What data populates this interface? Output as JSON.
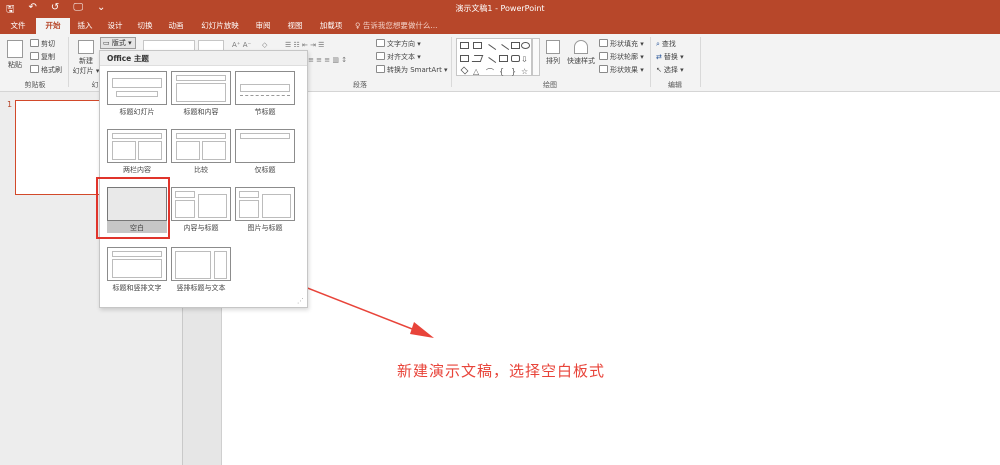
{
  "titlebar": {
    "doc_title": "演示文稿1 - PowerPoint",
    "qat": {
      "save": "🖫",
      "undo": "↶",
      "redo": "↺",
      "present": "🖵",
      "customize": "⌄"
    }
  },
  "tabs": [
    "文件",
    "开始",
    "插入",
    "设计",
    "切换",
    "动画",
    "幻灯片放映",
    "审阅",
    "视图",
    "加载项"
  ],
  "active_tab": "开始",
  "tell_me": "♀ 告诉我您想要做什么...",
  "ribbon": {
    "clipboard": {
      "paste": "粘贴",
      "cut": "剪切",
      "copy": "复制",
      "format_painter": "格式刷",
      "group_label": "剪贴板"
    },
    "slides": {
      "new_slide_line1": "新建",
      "new_slide_line2": "幻灯片 ▾",
      "layout": "版式 ▾",
      "group_label_partial": "幻"
    },
    "paragraph": {
      "text_direction": "文字方向 ▾",
      "align_text": "对齐文本 ▾",
      "convert_smartart": "转换为 SmartArt ▾",
      "group_label": "段落"
    },
    "drawing": {
      "arrange": "排列",
      "quick_styles": "快速样式",
      "shape_fill": "形状填充 ▾",
      "shape_outline": "形状轮廓 ▾",
      "shape_effects": "形状效果 ▾",
      "group_label": "绘图"
    },
    "editing": {
      "find": "查找",
      "replace": "替换 ▾",
      "select": "选择 ▾",
      "group_label": "编辑"
    }
  },
  "layout_gallery": {
    "header": "Office 主题",
    "layouts": [
      {
        "caption": "标题幻灯片"
      },
      {
        "caption": "标题和内容"
      },
      {
        "caption": "节标题"
      },
      {
        "caption": "两栏内容"
      },
      {
        "caption": "比较"
      },
      {
        "caption": "仅标题"
      },
      {
        "caption": "空白",
        "selected": true
      },
      {
        "caption": "内容与标题"
      },
      {
        "caption": "图片与标题"
      },
      {
        "caption": "标题和竖排文字"
      },
      {
        "caption": "竖排标题与文本"
      }
    ]
  },
  "thumbnail_pane": {
    "slide_number": "1"
  },
  "annotation": {
    "text": "新建演示文稿，选择空白板式",
    "color": "#e8443a"
  },
  "colors": {
    "accent": "#b7472a",
    "highlight": "#e0342b"
  }
}
